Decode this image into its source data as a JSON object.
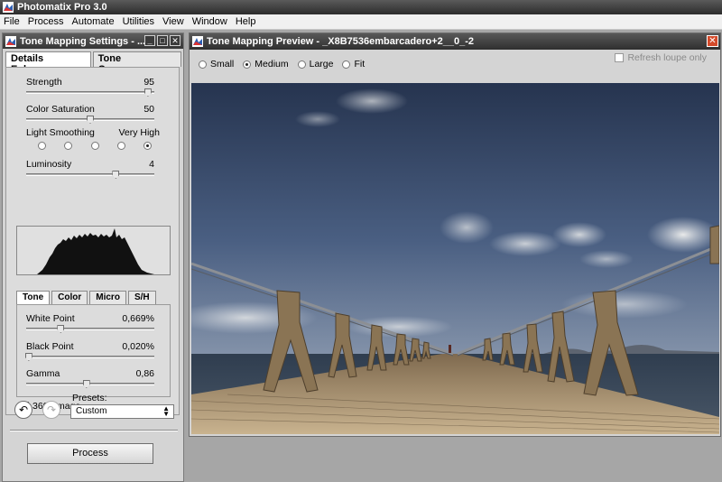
{
  "app": {
    "title": "Photomatix Pro 3.0"
  },
  "menu": [
    "File",
    "Process",
    "Automate",
    "Utilities",
    "View",
    "Window",
    "Help"
  ],
  "settings_panel": {
    "title": "Tone Mapping Settings - ...",
    "tabs": [
      {
        "label": "Details Enhancer",
        "active": true
      },
      {
        "label": "Tone Compressor",
        "active": false
      }
    ],
    "strength": {
      "label": "Strength",
      "value": "95",
      "level": 0.95
    },
    "color_saturation": {
      "label": "Color Saturation",
      "value": "50",
      "level": 0.5
    },
    "light_smoothing": {
      "label": "Light Smoothing",
      "max_label": "Very High",
      "options": 5,
      "selected": 5
    },
    "luminosity": {
      "label": "Luminosity",
      "value": "4",
      "level": 0.7
    },
    "subtabs": [
      {
        "label": "Tone",
        "active": true
      },
      {
        "label": "Color",
        "active": false
      },
      {
        "label": "Micro",
        "active": false
      },
      {
        "label": "S/H",
        "active": false
      }
    ],
    "white_point": {
      "label": "White Point",
      "value": "0,669%",
      "level": 0.27
    },
    "black_point": {
      "label": "Black Point",
      "value": "0,020%",
      "level": 0.02
    },
    "gamma": {
      "label": "Gamma",
      "value": "0,86",
      "level": 0.47
    },
    "image_360": {
      "label": "360° image",
      "checked": true
    },
    "presets": {
      "label": "Presets:",
      "selected": "Custom"
    },
    "process_label": "Process"
  },
  "preview": {
    "title": "Tone Mapping Preview - _X8B7536embarcadero+2__0_-2",
    "zoom_options": [
      {
        "label": "Small",
        "selected": false
      },
      {
        "label": "Medium",
        "selected": true
      },
      {
        "label": "Large",
        "selected": false
      },
      {
        "label": "Fit",
        "selected": false
      }
    ],
    "refresh_loupe": {
      "label": "Refresh loupe only",
      "checked": false
    }
  },
  "colors": {
    "title_bar": "#3a3a3a",
    "panel_bg": "#d4d4d4",
    "close_red": "#d44a2a",
    "sky_top": "#2e3e5c",
    "sky_bottom": "#a6b2c3",
    "pier_wood": "#8a7556"
  }
}
